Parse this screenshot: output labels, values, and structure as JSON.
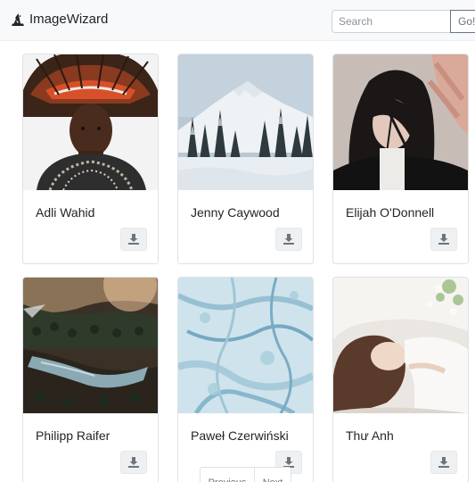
{
  "navbar": {
    "brand": "ImageWizard",
    "brand_icon": "wizard-hat-icon",
    "search_placeholder": "Search",
    "search_value": "",
    "go_label": "Go!"
  },
  "cards": [
    {
      "name": "Adli Wahid",
      "image": "portrait-headdress-photo"
    },
    {
      "name": "Jenny Caywood",
      "image": "snowy-mountain-photo"
    },
    {
      "name": "Elijah O'Donnell",
      "image": "woman-windblown-hair-photo"
    },
    {
      "name": "Philipp Raifer",
      "image": "forest-lake-aerial-photo"
    },
    {
      "name": "Paweł Czerwiński",
      "image": "blue-marble-texture-photo"
    },
    {
      "name": "Thư Anh",
      "image": "woman-in-bed-photo"
    }
  ],
  "download_icon": "download-icon",
  "pagination": {
    "previous": "Previous",
    "next": "Next"
  },
  "colors": {
    "navbar_bg": "#f8f9fa",
    "button_bg": "#eef0f2",
    "text": "#212529",
    "muted": "#6c757d"
  }
}
